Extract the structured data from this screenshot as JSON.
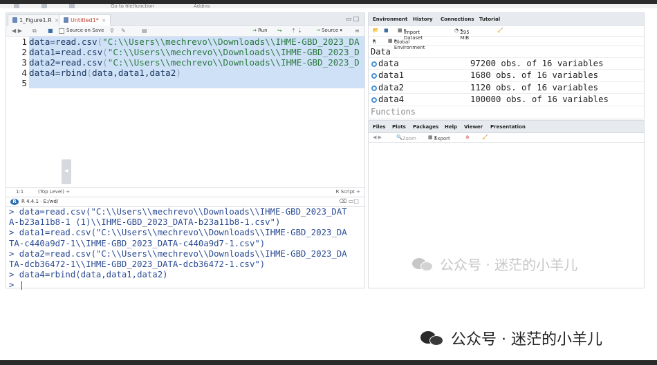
{
  "top": {
    "menu1": "Go to file/function",
    "menu2": "Addins"
  },
  "editor": {
    "tabs": [
      {
        "label": "1_Figure1.R"
      },
      {
        "label": "Untitled1*"
      }
    ],
    "toolbar": {
      "source_on_save": "Source on Save",
      "run": "Run",
      "source": "Source"
    },
    "lines": [
      {
        "num": "1",
        "pre": "data=read.csv",
        "paren": "(",
        "str": "\"C:\\\\Users\\\\mechrevo\\\\Downloads\\\\IHME-GBD_2023_DA"
      },
      {
        "num": "2",
        "pre": "data1=read.csv",
        "paren": "(",
        "str": "\"C:\\\\Users\\\\mechrevo\\\\Downloads\\\\IHME-GBD_2023_D"
      },
      {
        "num": "3",
        "pre": "data2=read.csv",
        "paren": "(",
        "str": "\"C:\\\\Users\\\\mechrevo\\\\Downloads\\\\IHME-GBD_2023_D"
      },
      {
        "num": "4",
        "pre": "data4=rbind",
        "paren": "(",
        "str": "data,data1,data2",
        "close": ")"
      },
      {
        "num": "5",
        "pre": "",
        "paren": "",
        "str": ""
      }
    ],
    "status": {
      "position": "1:1",
      "level": "(Top Level) ÷",
      "type": "R Script ÷"
    }
  },
  "console": {
    "version": "R 4.4.1 · E:/wd/",
    "lines": [
      "> data=read.csv(\"C:\\\\Users\\\\mechrevo\\\\Downloads\\\\IHME-GBD_2023_DAT",
      "A-b23a11b8-1 (1)\\\\IHME-GBD_2023_DATA-b23a11b8-1.csv\")",
      "> data1=read.csv(\"C:\\\\Users\\\\mechrevo\\\\Downloads\\\\IHME-GBD_2023_DA",
      "TA-c440a9d7-1\\\\IHME-GBD_2023_DATA-c440a9d7-1.csv\")",
      "> data2=read.csv(\"C:\\\\Users\\\\mechrevo\\\\Downloads\\\\IHME-GBD_2023_DA",
      "TA-dcb36472-1\\\\IHME-GBD_2023_DATA-dcb36472-1.csv\")",
      "> data4=rbind(data,data1,data2)",
      "> |"
    ]
  },
  "env": {
    "tabs": [
      "Environment",
      "History",
      "Connections",
      "Tutorial"
    ],
    "import_dataset": "Import Dataset",
    "memory": "295 MiB",
    "lang": "R",
    "scope": "Global Environment",
    "section_data": "Data",
    "rows": [
      {
        "name": "data",
        "value": "97200 obs. of 16 variables"
      },
      {
        "name": "data1",
        "value": "1680 obs. of 16 variables"
      },
      {
        "name": "data2",
        "value": "1120 obs. of 16 variables"
      },
      {
        "name": "data4",
        "value": "100000 obs. of 16 variables"
      }
    ],
    "section_functions": "Functions"
  },
  "files": {
    "tabs": [
      "Files",
      "Plots",
      "Packages",
      "Help",
      "Viewer",
      "Presentation"
    ],
    "zoom": "Zoom",
    "export": "Export"
  },
  "watermark": "公众号 · 迷茫的小羊儿",
  "caption": "公众号 · 迷茫的小羊儿"
}
